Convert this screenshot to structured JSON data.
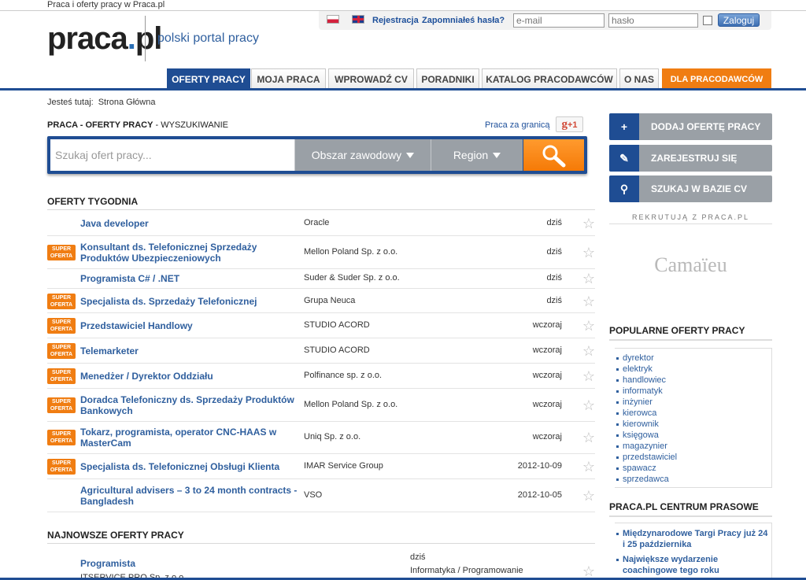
{
  "window": {
    "title": "Praca i oferty pracy w Praca.pl"
  },
  "header": {
    "logo": {
      "part1": "praca",
      "dot": ".",
      "part2": "pl"
    },
    "tagline": "polski portal pracy",
    "links": {
      "register": "Rejestracja",
      "forgot": "Zapomniałeś hasła?"
    },
    "email_placeholder": "e-mail",
    "password_placeholder": "hasło",
    "login_label": "Zaloguj"
  },
  "nav": {
    "tabs": [
      {
        "label": "OFERTY PRACY"
      },
      {
        "label": "MOJA PRACA"
      },
      {
        "label": "WPROWADŹ CV"
      },
      {
        "label": "PORADNIKI"
      },
      {
        "label": "KATALOG PRACODAWCÓW"
      },
      {
        "label": "O NAS"
      },
      {
        "label": "DLA PRACODAWCÓW"
      }
    ]
  },
  "breadcrumb": {
    "prefix": "Jesteś tutaj:",
    "current": "Strona Główna"
  },
  "search": {
    "title_bold": "PRACA - OFERTY PRACY",
    "title_rest": " - WYSZUKIWANIE",
    "abroad_link": "Praca za granicą",
    "gplus": "+1",
    "placeholder": "Szukaj ofert pracy...",
    "area_label": "Obszar zawodowy",
    "region_label": "Region"
  },
  "weekly": {
    "title": "OFERTY TYGODNIA",
    "badge_top": "SUPER",
    "badge_bottom": "OFERTA",
    "rows": [
      {
        "title": "Java developer",
        "company": "Oracle",
        "date": "dziś",
        "super": false
      },
      {
        "title": "Konsultant ds. Telefonicznej Sprzedaży Produktów Ubezpieczeniowych",
        "company": "Mellon Poland Sp. z o.o.",
        "date": "dziś",
        "super": true
      },
      {
        "title": "Programista C# / .NET",
        "company": "Suder & Suder Sp. z o.o.",
        "date": "dziś",
        "super": false
      },
      {
        "title": "Specjalista ds. Sprzedaży Telefonicznej",
        "company": "Grupa Neuca",
        "date": "dziś",
        "super": true
      },
      {
        "title": "Przedstawiciel Handlowy",
        "company": "STUDIO ACORD",
        "date": "wczoraj",
        "super": true
      },
      {
        "title": "Telemarketer",
        "company": "STUDIO ACORD",
        "date": "wczoraj",
        "super": true
      },
      {
        "title": "Menedżer / Dyrektor Oddziału",
        "company": "Polfinance sp. z o.o.",
        "date": "wczoraj",
        "super": true
      },
      {
        "title": "Doradca Telefoniczny ds. Sprzedaży Produktów Bankowych",
        "company": "Mellon Poland Sp. z o.o.",
        "date": "wczoraj",
        "super": true
      },
      {
        "title": "Tokarz, programista, operator CNC-HAAS w MasterCam",
        "company": "Uniq Sp. z o.o.",
        "date": "wczoraj",
        "super": true
      },
      {
        "title": "Specjalista ds. Telefonicznej Obsługi Klienta",
        "company": "IMAR Service Group",
        "date": "2012-10-09",
        "super": true
      },
      {
        "title": "Agricultural advisers – 3 to 24 month contracts - Bangladesh",
        "company": "VSO",
        "date": "2012-10-05",
        "super": false
      }
    ]
  },
  "newest": {
    "title": "NAJNOWSZE OFERTY PRACY",
    "first": {
      "title": "Programista",
      "company": "ITSERVICE PRO Sp. z o.o.",
      "date": "dziś",
      "category": "Informatyka / Programowanie"
    }
  },
  "sidebar": {
    "buttons": [
      {
        "icon": "+",
        "label": "DODAJ OFERTĘ PRACY"
      },
      {
        "icon": "✎",
        "label": "ZAREJESTRUJ SIĘ"
      },
      {
        "icon": "⚲",
        "label": "SZUKAJ W BAZIE CV"
      }
    ],
    "recruit_label": "REKRUTUJĄ Z PRACA.PL",
    "recruiter_logo": "Camaïeu",
    "popular_title": "POPULARNE OFERTY PRACY",
    "popular": [
      "dyrektor",
      "elektryk",
      "handlowiec",
      "informatyk",
      "inżynier",
      "kierowca",
      "kierownik",
      "księgowa",
      "magazynier",
      "przedstawiciel",
      "spawacz",
      "sprzedawca"
    ],
    "press_title": "PRACA.PL CENTRUM PRASOWE",
    "press": [
      "Międzynarodowe Targi Pracy już 24 i 25 października",
      "Największe wydarzenie coachingowe tego roku"
    ]
  },
  "colors": {
    "brand_blue": "#1f4d93",
    "accent_orange": "#f07d12",
    "link_blue": "#2f5f9e"
  }
}
